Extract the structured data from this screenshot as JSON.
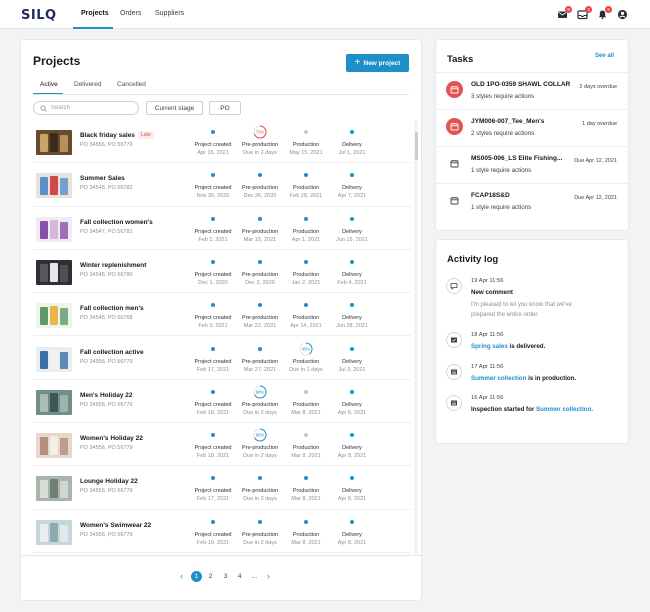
{
  "nav": {
    "logo": "SILQ",
    "items": [
      "Projects",
      "Orders",
      "Suppliers"
    ],
    "badges": {
      "messages": "9",
      "inbox": "3",
      "alerts": "2"
    }
  },
  "projects": {
    "title": "Projects",
    "new_button": "New project",
    "tabs": [
      "Active",
      "Delivered",
      "Cancelled"
    ],
    "search_placeholder": "Search",
    "filters": [
      "Current stage",
      "PO"
    ],
    "stage_labels": [
      "Project created",
      "Pre-production",
      "Production",
      "Delivery"
    ],
    "rows": [
      {
        "name": "Black friday sales",
        "po": "PO 34556, PO 56779",
        "late": "Late",
        "thumb": "bf",
        "dates": [
          "Apr 15, 2021",
          "Due in 2 days",
          "May 15, 2021",
          "Jul 1, 2021"
        ],
        "stage_marks": [
          "done",
          "ring-red:70%",
          "todo",
          "done"
        ],
        "progress": 0.7
      },
      {
        "name": "Summer Sales",
        "po": "PO 34548, PO 56782",
        "thumb": "ss",
        "dates": [
          "Nov 30, 2020",
          "Dec 26, 2020",
          "Feb 28, 2021",
          "Apr 7, 2021"
        ],
        "stage_marks": [
          "done",
          "done",
          "done",
          "done"
        ]
      },
      {
        "name": "Fall collection women's",
        "po": "PO 34547, PO 56781",
        "thumb": "fw",
        "dates": [
          "Feb 1, 2021",
          "Mar 15, 2021",
          "Apr 1, 2021",
          "Jun 15, 2021"
        ],
        "stage_marks": [
          "done",
          "done",
          "done",
          "done"
        ]
      },
      {
        "name": "Winter replenishment",
        "po": "PO 34546, PO 56780",
        "thumb": "wr",
        "dates": [
          "Dec 1, 2020",
          "Dec 3, 2020",
          "Jan 2, 2021",
          "Feb 4, 2021"
        ],
        "stage_marks": [
          "done",
          "done",
          "done",
          "done"
        ]
      },
      {
        "name": "Fall collection men's",
        "po": "PO 34545, PO 56768",
        "thumb": "fm",
        "dates": [
          "Feb 3, 2021",
          "Mar 22, 2021",
          "Apr 14, 2021",
          "Jun 28, 2021"
        ],
        "stage_marks": [
          "done",
          "done",
          "done",
          "done"
        ]
      },
      {
        "name": "Fall collection active",
        "po": "PO 34556, PO 56779",
        "thumb": "fa",
        "dates": [
          "Feb 17, 2021",
          "Mar 27, 2021",
          "Due in 2 days",
          "Jul 3, 2021"
        ],
        "stage_marks": [
          "done",
          "done",
          "ring-blue:40%",
          "done"
        ],
        "progress": 0.4
      },
      {
        "name": "Men's Holiday 22",
        "po": "PO 34556, PO 56779",
        "thumb": "mh",
        "dates": [
          "Feb 18, 2021",
          "Due in 2 days",
          "Mar 8, 2021",
          "Apr 8, 2021"
        ],
        "stage_marks": [
          "done",
          "ring-blue:68%",
          "todo",
          "done"
        ],
        "progress": 0.68
      },
      {
        "name": "Women's Holiday 22",
        "po": "PO 34556, PO 56779",
        "thumb": "wh",
        "dates": [
          "Feb 18, 2021",
          "Due in 2 days",
          "Mar 8, 2021",
          "Apr 8, 2021"
        ],
        "stage_marks": [
          "done",
          "ring-blue:68%",
          "todo",
          "done"
        ],
        "progress": 0.68
      },
      {
        "name": "Lounge Holiday 22",
        "po": "PO 34556, PO 56779",
        "thumb": "lh",
        "dates": [
          "Feb 17, 2021",
          "Due in 2 days",
          "Mar 8, 2021",
          "Apr 8, 2021"
        ],
        "stage_marks": [
          "done",
          "done",
          "done",
          "done"
        ]
      },
      {
        "name": "Women's Swimwear 22",
        "po": "PO 34556, PO 56779",
        "thumb": "sw",
        "dates": [
          "Feb 19, 2021",
          "Due in 2 days",
          "Mar 8, 2021",
          "Apr 8, 2021"
        ],
        "stage_marks": [
          "done",
          "done",
          "done",
          "done"
        ]
      }
    ],
    "pagination": {
      "pages": [
        "1",
        "2",
        "3",
        "4",
        "..."
      ],
      "current": "1"
    }
  },
  "tasks": {
    "title": "Tasks",
    "see_all": "See all",
    "items": [
      {
        "name": "OLD 1PO-0359 SHAWL COLLAR",
        "desc": "3 styles require actions",
        "due": "2 days overdue",
        "status": "overdue"
      },
      {
        "name": "JYM006-007_Tee_Men's",
        "desc": "2 styles require actions",
        "due": "1 day overdue",
        "status": "overdue"
      },
      {
        "name": "MS005-006_LS Elite Fishing...",
        "desc": "1 style require actions",
        "due": "Due Apr 12, 2021",
        "status": "normal"
      },
      {
        "name": "FCAP18S&D",
        "desc": "1 style require actions",
        "due": "Due Apr 12, 2021",
        "status": "normal"
      }
    ]
  },
  "activity": {
    "title": "Activity log",
    "items": [
      {
        "time": "19 Apr 11:56",
        "text": "New comment",
        "body": [
          "I'm pleased to let you know that we've",
          "prepared the entire order."
        ],
        "icon": "comment-icon"
      },
      {
        "time": "18 Apr 11:56",
        "link": "Spring sales",
        "suffix": " is delivered.",
        "icon": "delivered-icon"
      },
      {
        "time": "17 Apr 11:56",
        "link": "Summer collection",
        "suffix": " is in production.",
        "icon": "production-icon"
      },
      {
        "time": "16 Apr 11:56",
        "prefix": "Inspection started for ",
        "link": "Summer collection.",
        "icon": "inspection-icon"
      }
    ]
  },
  "colors": {
    "accent": "#1e8fc9",
    "danger": "#e14c4c",
    "todo": "#c4c8ce"
  }
}
